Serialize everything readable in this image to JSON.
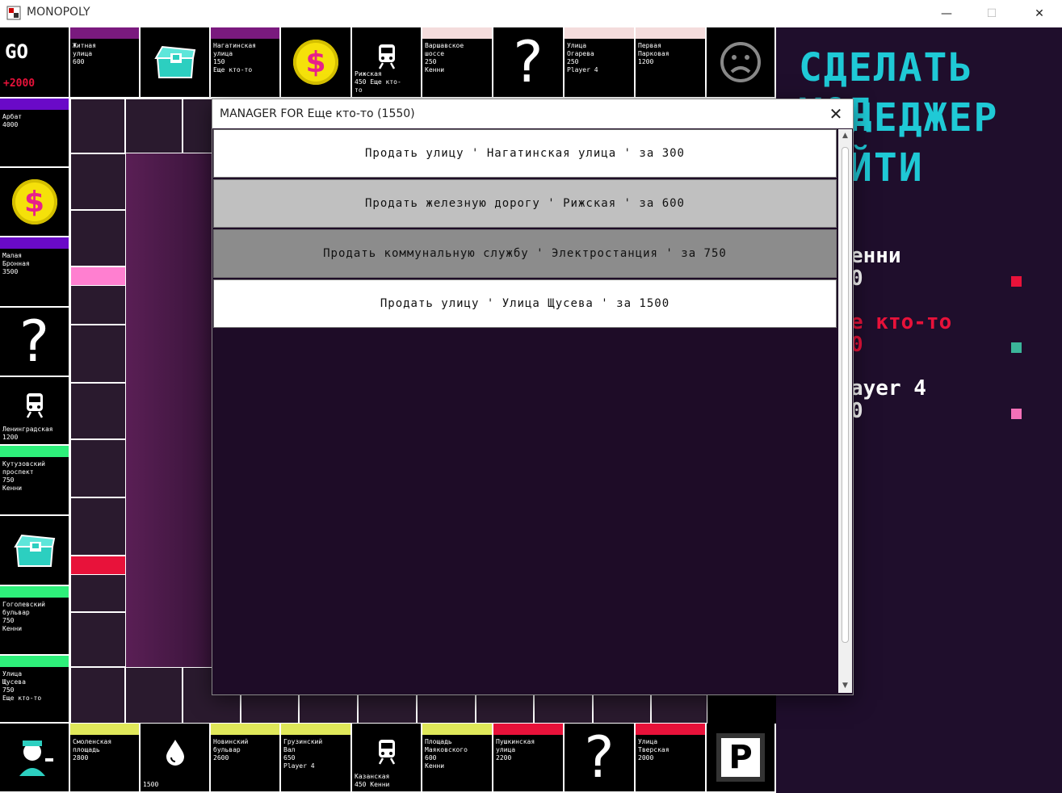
{
  "window": {
    "title": "MONOPOLY",
    "minimize": "—",
    "maximize": "☐",
    "close": "✕"
  },
  "board": {
    "corners": {
      "go": {
        "label": "GO",
        "bonus": "+2000"
      }
    },
    "top_row": [
      {
        "name": "Житная\nулица\n 600",
        "color": "#7a1a7e",
        "type": "street"
      },
      {
        "name": "",
        "icon": "chest",
        "type": "chest"
      },
      {
        "name": "Нагатинская\nулица\n150\n Еще кто-то",
        "color": "#7a1a7e",
        "type": "street"
      },
      {
        "name": "",
        "icon": "coin",
        "type": "tax"
      },
      {
        "name": "Рижская\n 450  Еще кто-\nто",
        "icon": "train",
        "type": "rail"
      },
      {
        "name": "Варшавское\nшоссе\n 250\n  Кенни",
        "color": "#f4dcdc",
        "type": "street"
      },
      {
        "name": "",
        "icon": "question",
        "type": "chance"
      },
      {
        "name": "Улица\nОгарева\n 250\n  Player 4",
        "color": "#f4dcdc",
        "type": "street"
      },
      {
        "name": "Первая\nПарковая\n 1200",
        "color": "#f4dcdc",
        "type": "street"
      },
      {
        "name": "",
        "icon": "sad",
        "type": "jail"
      }
    ],
    "left_col": [
      {
        "name": "Арбат\n 4000",
        "color": "#6a0ac8",
        "type": "street"
      },
      {
        "name": "",
        "icon": "coin",
        "type": "tax"
      },
      {
        "name": "Малая\nБронная\n 3500",
        "color": "#6a0ac8",
        "type": "street"
      },
      {
        "name": "",
        "icon": "question",
        "type": "chance"
      },
      {
        "name": "Ленинградская\n1200",
        "icon": "train",
        "type": "rail"
      },
      {
        "name": "Кутузовский\nпроспект\n 750\n  Кенни",
        "color": "#2ef07a",
        "type": "street"
      },
      {
        "name": "",
        "icon": "chest",
        "type": "chest"
      },
      {
        "name": "Гоголевский\nбульвар\n 750\n  Кенни",
        "color": "#2ef07a",
        "type": "street"
      },
      {
        "name": "Улица\nЩусева\n 750\n  Еще кто-то",
        "color": "#2ef07a",
        "type": "street"
      }
    ],
    "bottom_row": [
      {
        "name": "",
        "icon": "police",
        "type": "gotojail"
      },
      {
        "name": "Смоленская\nплощадь\n 2800",
        "color": "#e0e85a",
        "type": "street"
      },
      {
        "name": "1500",
        "icon": "drop",
        "type": "utility"
      },
      {
        "name": "Новинский\nбульвар\n 2600",
        "color": "#e0e85a",
        "type": "street"
      },
      {
        "name": "Грузинский\nВал\n 650\n  Player 4",
        "color": "#e0e85a",
        "type": "street"
      },
      {
        "name": "Казанская\n450  Кенни",
        "icon": "train",
        "type": "rail"
      },
      {
        "name": "Площадь\nМаяковского\n 600\n  Кенни",
        "color": "#e0e85a",
        "type": "street"
      },
      {
        "name": "Пушкинская\nулица\n 2200",
        "color": "#e8123a",
        "type": "street"
      },
      {
        "name": "",
        "icon": "question",
        "type": "chance"
      },
      {
        "name": "Улица\nТверская\n 2000",
        "color": "#e8123a",
        "type": "street"
      },
      {
        "name": "P",
        "icon": "parking",
        "type": "parking"
      }
    ]
  },
  "panel": {
    "make_move": "СДЕЛАТЬ ХОД",
    "manager_fragment": "НЕДЖЕР",
    "exit_fragment": "ЙТИ",
    "players": [
      {
        "name": "енни",
        "money": "0",
        "color": "#e8123a",
        "name_color": "#ffffff"
      },
      {
        "name": "е кто-то",
        "money": "0",
        "color": "#3bb59a",
        "name_color": "#e8123a"
      },
      {
        "name": "ayer 4",
        "money": "0",
        "color": "#f470b8",
        "name_color": "#ffffff"
      }
    ]
  },
  "modal": {
    "title": "MANAGER FOR  Еще кто-то (1550)",
    "close": "✕",
    "options": [
      {
        "label": "Продать улицу ' Нагатинская улица ' за 300",
        "bg": "#ffffff"
      },
      {
        "label": "Продать железную дорогу ' Рижская ' за 600",
        "bg": "#c0c0c0"
      },
      {
        "label": "Продать коммунальную службу ' Электростанция ' за 750",
        "bg": "#8c8c8c"
      },
      {
        "label": "Продать улицу ' Улица Щусева ' за 1500",
        "bg": "#ffffff"
      }
    ]
  }
}
